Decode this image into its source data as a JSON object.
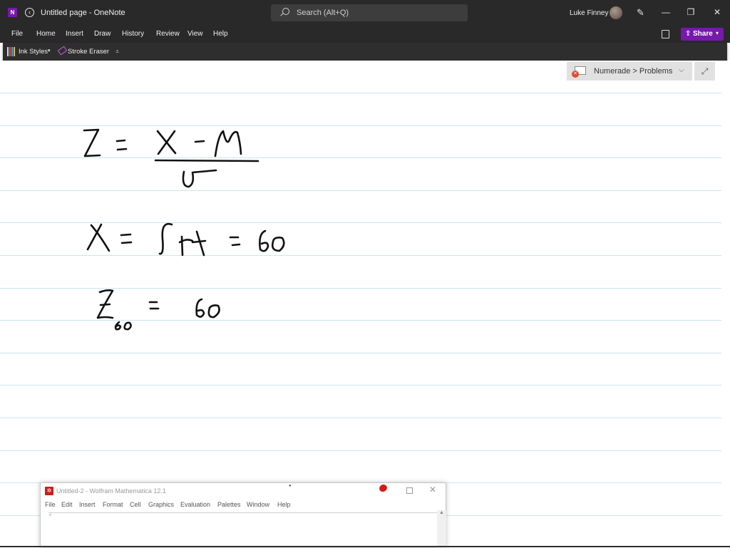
{
  "window": {
    "title": "Untitled page  -  OneNote",
    "app_icon": "onenote-icon",
    "search_placeholder": "Search (Alt+Q)",
    "user_name": "Luke Finney",
    "controls": {
      "minimize": "—",
      "restore": "❐",
      "close": "✕"
    }
  },
  "menu": {
    "items": [
      "File",
      "Home",
      "Insert",
      "Draw",
      "History",
      "Review",
      "View",
      "Help"
    ],
    "share_label": "Share"
  },
  "ribbon": {
    "ink_styles_label": "Ink Styles",
    "stroke_eraser_label": "Stroke Eraser",
    "more_label": "⩡"
  },
  "page": {
    "notebook_breadcrumb": "Numerade > Problems",
    "expand_icon": "⤢",
    "handwritten_notes": [
      "Z = (X − μ) / σ",
      "X = ∫ rt = 60",
      "Z₆₀ = 60"
    ]
  },
  "mathematica": {
    "title": "Untitled-2 - Wolfram Mathematica 12.1",
    "menu": [
      "File",
      "Edit",
      "Insert",
      "Format",
      "Cell",
      "Graphics",
      "Evaluation",
      "Palettes",
      "Window",
      "Help"
    ],
    "close": "✕",
    "cell_insert": "+"
  },
  "colors": {
    "onenote_purple": "#7719aa",
    "titlebar": "#292929",
    "rule_line": "#c8e6f0",
    "mathematica_red": "#c8211d"
  }
}
